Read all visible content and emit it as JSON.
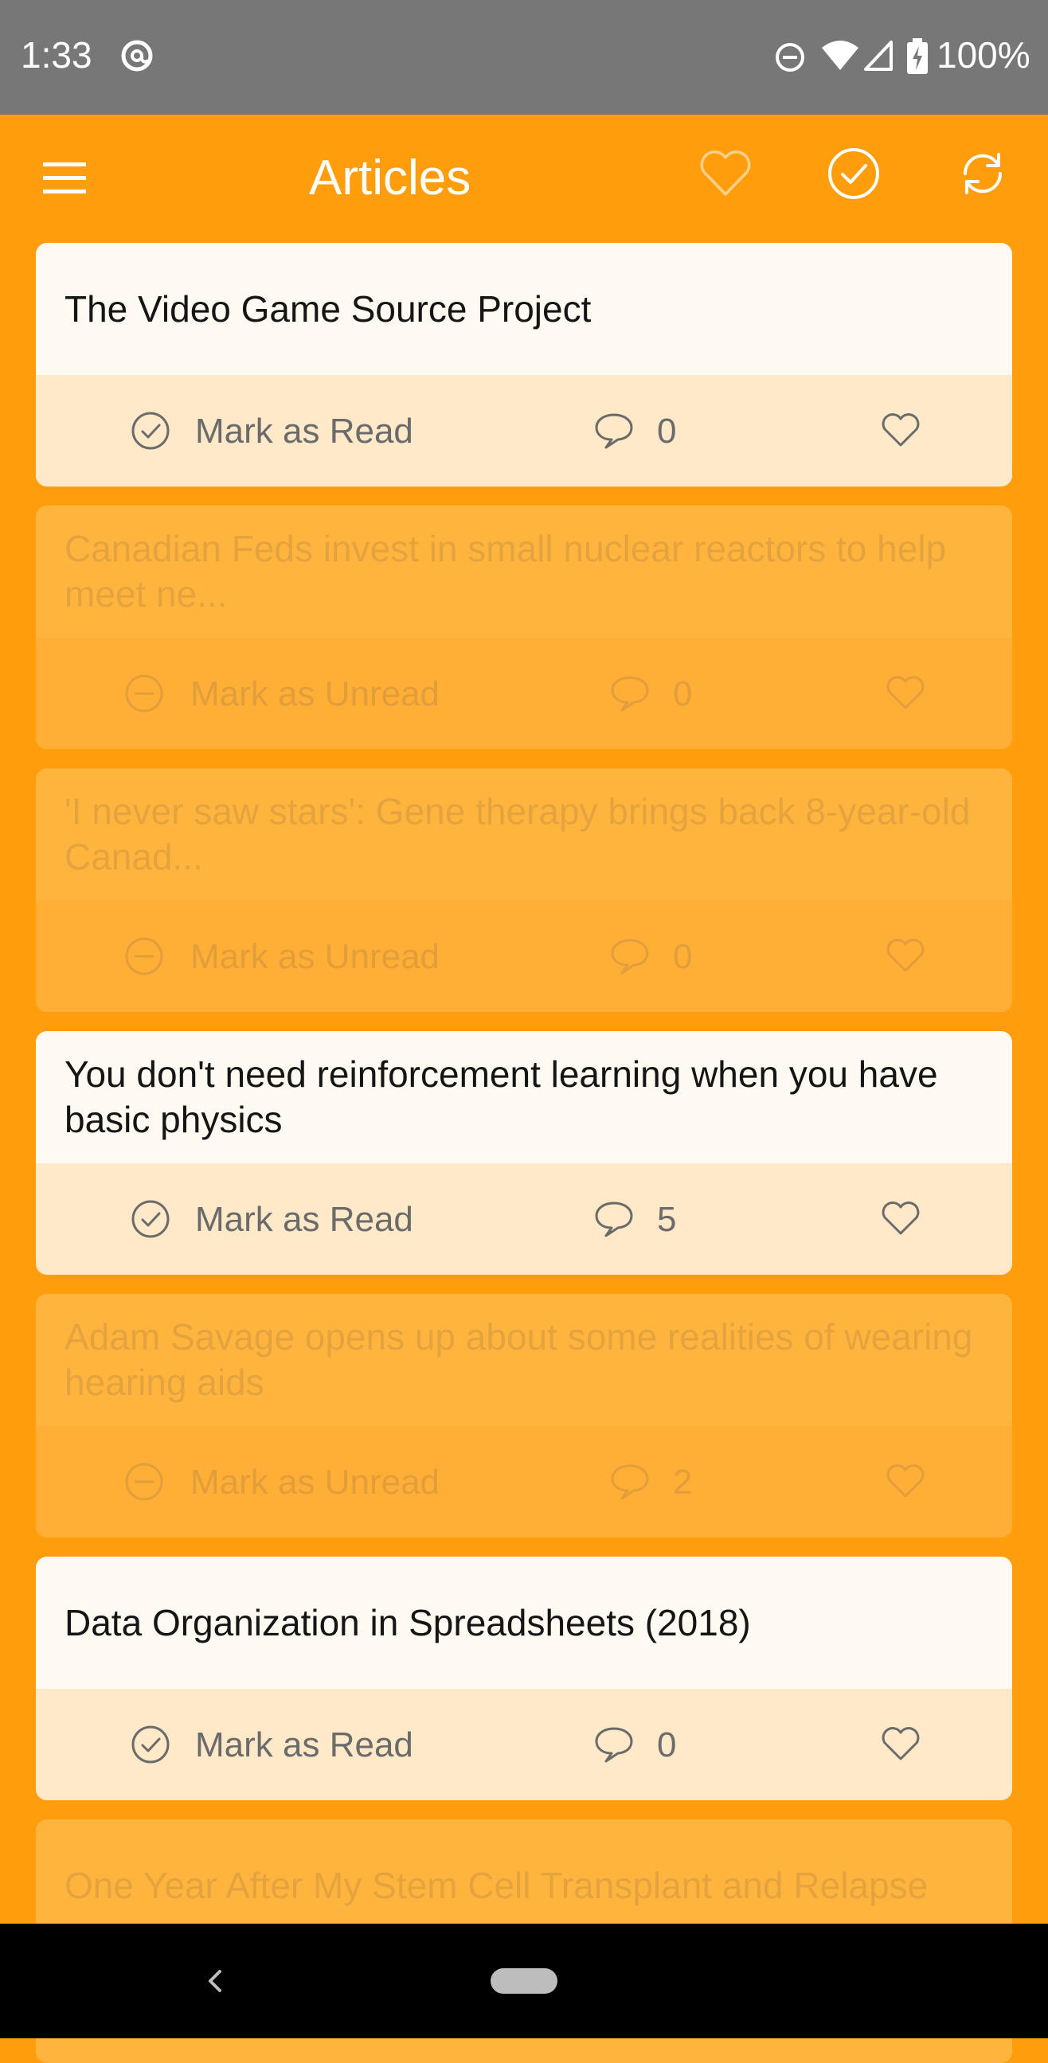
{
  "status_bar": {
    "time": "1:33",
    "battery": "100%",
    "icons": [
      "at-sign-icon",
      "do-not-disturb-icon",
      "wifi-icon",
      "cell-signal-icon",
      "battery-charging-icon"
    ]
  },
  "app_bar": {
    "title": "Articles",
    "icons": [
      "menu-icon",
      "heart-icon",
      "check-circle-icon",
      "refresh-icon"
    ]
  },
  "colors": {
    "accent": "#ff9d0d",
    "status_bar": "#777777",
    "card_unread": "#fffaf1",
    "card_read": "#ffb53d"
  },
  "articles": [
    {
      "title": "The Video Game Source Project",
      "state": "unread",
      "action_label": "Mark as Read",
      "comments": "0"
    },
    {
      "title": "Canadian Feds invest in small nuclear reactors to help meet ne...",
      "state": "read",
      "action_label": "Mark as Unread",
      "comments": "0"
    },
    {
      "title": "'I never saw stars': Gene therapy brings back 8-year-old Canad...",
      "state": "read",
      "action_label": "Mark as Unread",
      "comments": "0"
    },
    {
      "title": "You don't need reinforcement learning when you have basic physics",
      "state": "unread",
      "action_label": "Mark as Read",
      "comments": "5"
    },
    {
      "title": "Adam Savage opens up about some realities of wearing hearing aids",
      "state": "read",
      "action_label": "Mark as Unread",
      "comments": "2"
    },
    {
      "title": "Data Organization in Spreadsheets (2018)",
      "state": "unread",
      "action_label": "Mark as Read",
      "comments": "0"
    },
    {
      "title": "One Year After My Stem Cell Transplant and Relapse",
      "state": "read",
      "action_label": "",
      "comments": ""
    }
  ]
}
